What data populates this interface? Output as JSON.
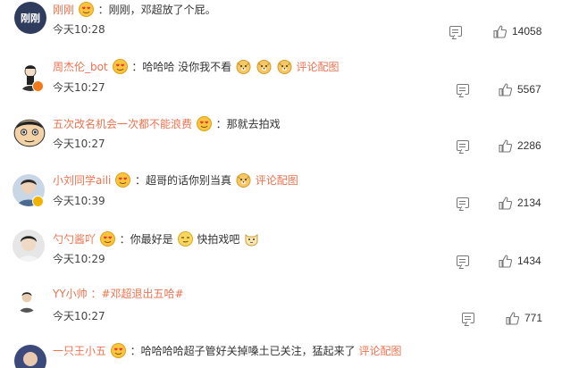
{
  "comments": [
    {
      "user": "刚刚",
      "avatar_text": "刚刚",
      "badge_emoji": "heart-eyes-emoji",
      "text": "：刚刚，邓超放了个屁。",
      "time": "今天10:28",
      "likes": "14058"
    },
    {
      "user": "周杰伦_bot",
      "badge_emoji": "heart-eyes-emoji",
      "text": "：哈哈哈 没你我不看",
      "emojis": [
        "doge-emoji",
        "doge-emoji",
        "doge-emoji"
      ],
      "link": "评论配图",
      "time": "今天10:27",
      "likes": "5567",
      "verified": "orange"
    },
    {
      "user": "五次改名机会一次都不能浪费",
      "badge_emoji": "heart-eyes-emoji",
      "text": "：那就去拍戏",
      "time": "今天10:27",
      "likes": "2286"
    },
    {
      "user": "小刘同学aili",
      "badge_emoji": "heart-eyes-emoji",
      "text": "：超哥的话你别当真",
      "emojis": [
        "doge-emoji"
      ],
      "link": "评论配图",
      "time": "今天10:39",
      "likes": "2134",
      "verified": "gold"
    },
    {
      "user": "勺勺酱吖",
      "badge_emoji": "heart-eyes-emoji",
      "text_before": "：你最好是",
      "emoji_mid": "smirk-emoji",
      "text_after": "快拍戏吧",
      "emoji_end": "cat-emoji",
      "time": "今天10:29",
      "likes": "1434"
    },
    {
      "user": "YY小帅",
      "text": "：#邓超退出五哈#",
      "time": "今天10:27",
      "likes": "771"
    },
    {
      "user": "一只王小五",
      "badge_emoji": "heart-eyes-emoji",
      "text": "：哈哈哈哈超子管好关掉嗓土已关注，猛起来了",
      "link": "评论配图"
    }
  ],
  "colors": {
    "username": "#eb7350",
    "text": "#333333",
    "meta": "#444444"
  }
}
